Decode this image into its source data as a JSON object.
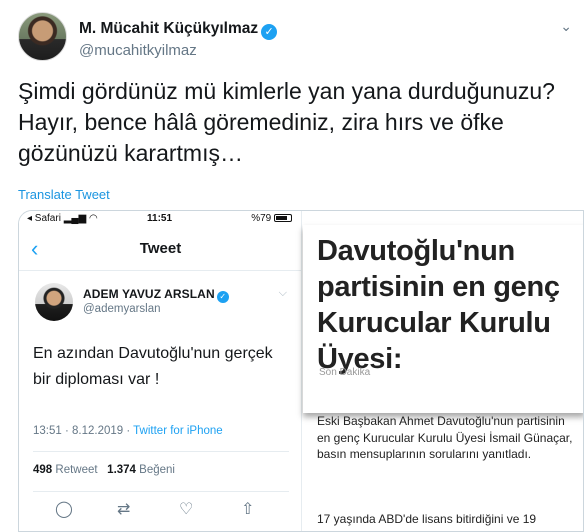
{
  "author": {
    "name": "M. Mücahit Küçükyılmaz",
    "handle": "@mucahitkyilmaz"
  },
  "tweet": {
    "text": "Şimdi gördünüz mü kimlerle yan yana durduğunuzu? Hayır, bence hâlâ göremediniz, zira hırs ve öfke gözünüzü karartmış…",
    "translate_label": "Translate Tweet"
  },
  "phone": {
    "carrier": "◂ Safari",
    "time": "11:51",
    "battery": "%79",
    "nav_title": "Tweet",
    "quoted": {
      "name": "ADEM YAVUZ ARSLAN",
      "handle": "@ademyarslan",
      "text": "En azından Davutoğlu'nun gerçek bir diploması var !",
      "timestamp": "13:51 · 8.12.2019 · ",
      "client": "Twitter for iPhone",
      "retweets": "498",
      "retweets_label": "Retweet",
      "likes": "1.374",
      "likes_label": "Beğeni"
    }
  },
  "article": {
    "headline": "Davutoğlu'nun partisinin en genç Kurucular Kurulu Üyesi:",
    "source_tag": "Son Dakika",
    "paragraph1": "Eski Başbakan Ahmet Davutoğlu'nun partisinin en genç Kurucular Kurulu Üyesi İsmail Günaçar, basın mensuplarının sorularını yanıtladı.",
    "paragraph2": "17 yaşında ABD'de lisans bitirdiğini ve 19"
  },
  "colors": {
    "accent": "#1da1f2",
    "link": "#1b95e0",
    "secondary_text": "#657786"
  }
}
